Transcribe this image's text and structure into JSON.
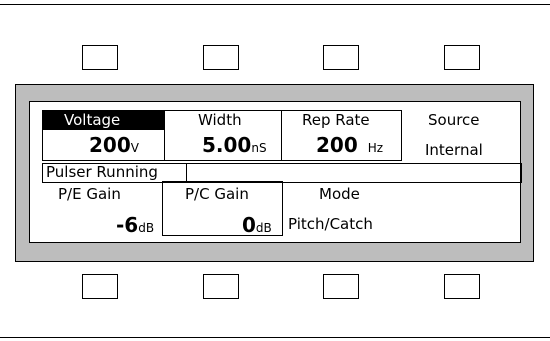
{
  "screen": {
    "voltage": {
      "label": "Voltage",
      "value": "200",
      "unit": "V"
    },
    "width": {
      "label": "Width",
      "value": "5.00",
      "unit": "nS"
    },
    "rep_rate": {
      "label": "Rep Rate",
      "value": "200",
      "unit": "Hz"
    },
    "source": {
      "label": "Source",
      "value": "Internal"
    },
    "status": "Pulser Running",
    "pe_gain": {
      "label": "P/E Gain",
      "value": "-6",
      "unit": "dB"
    },
    "pc_gain": {
      "label": "P/C Gain",
      "value": "0",
      "unit": "dB"
    },
    "mode": {
      "label": "Mode",
      "value": "Pitch/Catch"
    }
  }
}
